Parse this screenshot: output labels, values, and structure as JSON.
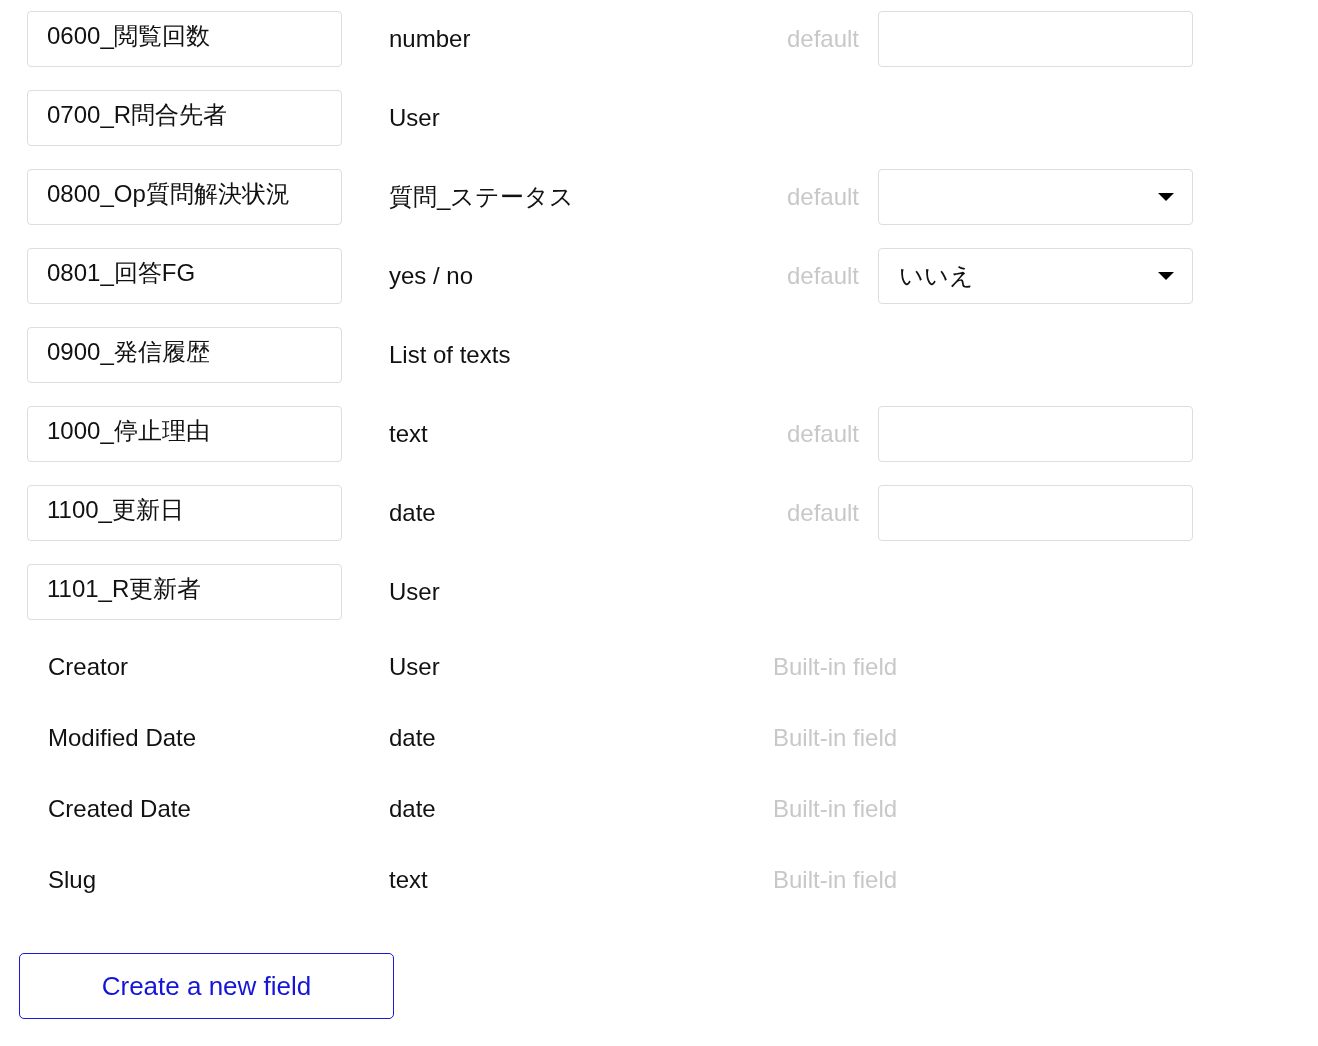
{
  "fields": [
    {
      "kind": "custom",
      "name": "0600_閲覧回数",
      "type": "number",
      "default": {
        "kind": "input",
        "label": "default"
      }
    },
    {
      "kind": "custom",
      "name": "0700_R問合先者",
      "type": "User"
    },
    {
      "kind": "custom",
      "name": "0800_Op質問解決状況",
      "type": "質問_ステータス",
      "default": {
        "kind": "select",
        "label": "default"
      }
    },
    {
      "kind": "custom",
      "name": "0801_回答FG",
      "type": "yes / no",
      "default": {
        "kind": "select",
        "label": "default",
        "value": "いいえ"
      }
    },
    {
      "kind": "custom",
      "name": "0900_発信履歴",
      "type": "List of texts"
    },
    {
      "kind": "custom",
      "name": "1000_停止理由",
      "type": "text",
      "default": {
        "kind": "input",
        "label": "default"
      }
    },
    {
      "kind": "custom",
      "name": "1100_更新日",
      "type": "date",
      "default": {
        "kind": "input",
        "label": "default"
      }
    },
    {
      "kind": "custom",
      "name": "1101_R更新者",
      "type": "User"
    },
    {
      "kind": "builtin",
      "name": "Creator",
      "type": "User",
      "note": "Built-in field"
    },
    {
      "kind": "builtin",
      "name": "Modified Date",
      "type": "date",
      "note": "Built-in field"
    },
    {
      "kind": "builtin",
      "name": "Created Date",
      "type": "date",
      "note": "Built-in field"
    },
    {
      "kind": "builtin",
      "name": "Slug",
      "type": "text",
      "note": "Built-in field"
    }
  ],
  "create_button": "Create a new field"
}
